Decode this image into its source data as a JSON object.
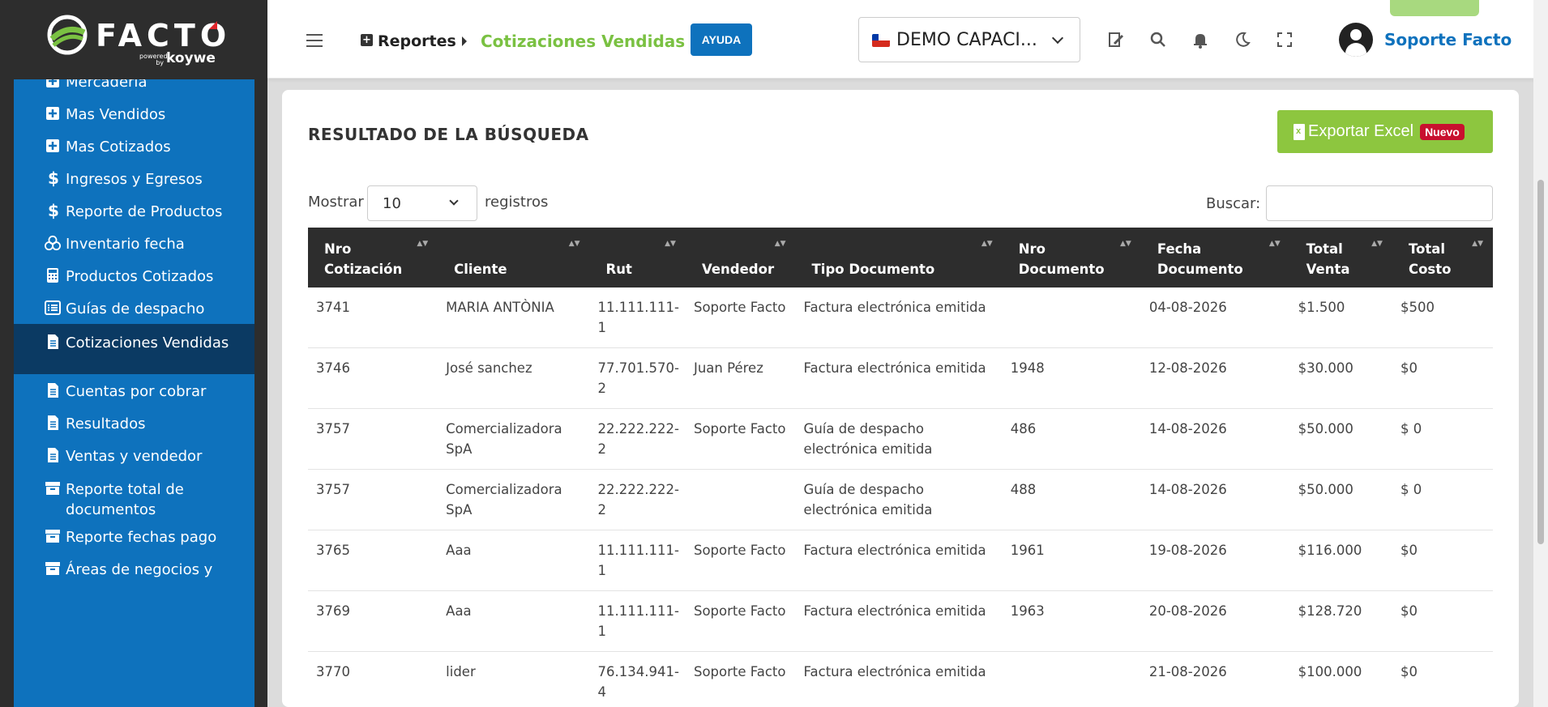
{
  "logo": {
    "brand": "FACTO",
    "powered": "powered by",
    "partner": "koywe"
  },
  "sidebar": {
    "items": [
      {
        "label": "Mercadería",
        "icon": "plus-square-icon"
      },
      {
        "label": "Mas Vendidos",
        "icon": "plus-square-icon"
      },
      {
        "label": "Mas Cotizados",
        "icon": "plus-square-icon"
      },
      {
        "label": "Ingresos y Egresos",
        "icon": "dollar-icon"
      },
      {
        "label": "Reporte de Productos",
        "icon": "dollar-icon"
      },
      {
        "label": "Inventario fecha",
        "icon": "boxes-icon"
      },
      {
        "label": "Productos Cotizados",
        "icon": "calculator-icon"
      },
      {
        "label": "Guías de despacho",
        "icon": "list-icon"
      },
      {
        "label": "Cotizaciones Vendidas",
        "icon": "document-icon"
      },
      {
        "label": "Cuentas por cobrar",
        "icon": "document-icon"
      },
      {
        "label": "Resultados",
        "icon": "document-icon"
      },
      {
        "label": "Ventas y vendedor",
        "icon": "document-icon"
      },
      {
        "label": "Reporte total de documentos",
        "icon": "archive-icon"
      },
      {
        "label": "Reporte fechas pago",
        "icon": "archive-icon"
      },
      {
        "label": "Áreas de negocios y",
        "icon": "archive-icon"
      }
    ],
    "active_index": 8
  },
  "topbar": {
    "breadcrumb_root": "Reportes",
    "breadcrumb_current": "Cotizaciones Vendidas",
    "help_label": "AYUDA",
    "company": "DEMO CAPACI...",
    "user_name": "Soporte Facto"
  },
  "content": {
    "title": "RESULTADO DE LA BÚSQUEDA",
    "export_label": "Exportar Excel",
    "export_badge": "Nuevo",
    "show_label": "Mostrar",
    "show_value": "10",
    "records_label": "registros",
    "search_label": "Buscar:",
    "search_value": ""
  },
  "table": {
    "headers": [
      "Nro Cotización",
      "Cliente",
      "Rut",
      "Vendedor",
      "Tipo Documento",
      "Nro Documento",
      "Fecha Documento",
      "Total Venta",
      "Total Costo"
    ],
    "rows": [
      [
        "3741",
        "MARIA ANTÒNIA",
        "11.111.111-1",
        "Soporte Facto",
        "Factura electrónica emitida",
        "",
        "04-08-2026",
        "$1.500",
        "$500"
      ],
      [
        "3746",
        "José sanchez",
        "77.701.570-2",
        "Juan Pérez",
        "Factura electrónica emitida",
        "1948",
        "12-08-2026",
        "$30.000",
        "$0"
      ],
      [
        "3757",
        "Comercializadora SpA",
        "22.222.222-2",
        "Soporte Facto",
        "Guía de despacho electrónica emitida",
        "486",
        "14-08-2026",
        "$50.000",
        "$ 0"
      ],
      [
        "3757",
        "Comercializadora SpA",
        "22.222.222-2",
        "",
        "Guía de despacho electrónica emitida",
        "488",
        "14-08-2026",
        "$50.000",
        "$ 0"
      ],
      [
        "3765",
        "Aaa",
        "11.111.111-1",
        "Soporte Facto",
        "Factura electrónica emitida",
        "1961",
        "19-08-2026",
        "$116.000",
        "$0"
      ],
      [
        "3769",
        "Aaa",
        "11.111.111-1",
        "Soporte Facto",
        "Factura electrónica emitida",
        "1963",
        "20-08-2026",
        "$128.720",
        "$0"
      ],
      [
        "3770",
        "lider",
        "76.134.941-4",
        "Soporte Facto",
        "Factura electrónica emitida",
        "",
        "21-08-2026",
        "$100.000",
        "$0"
      ]
    ]
  },
  "colors": {
    "sidebar_blue": "#0e72bd",
    "active_dark": "#0b3a63",
    "green": "#8dc63f",
    "header_dark": "#2d2d2d",
    "badge_red": "#c8102e"
  }
}
